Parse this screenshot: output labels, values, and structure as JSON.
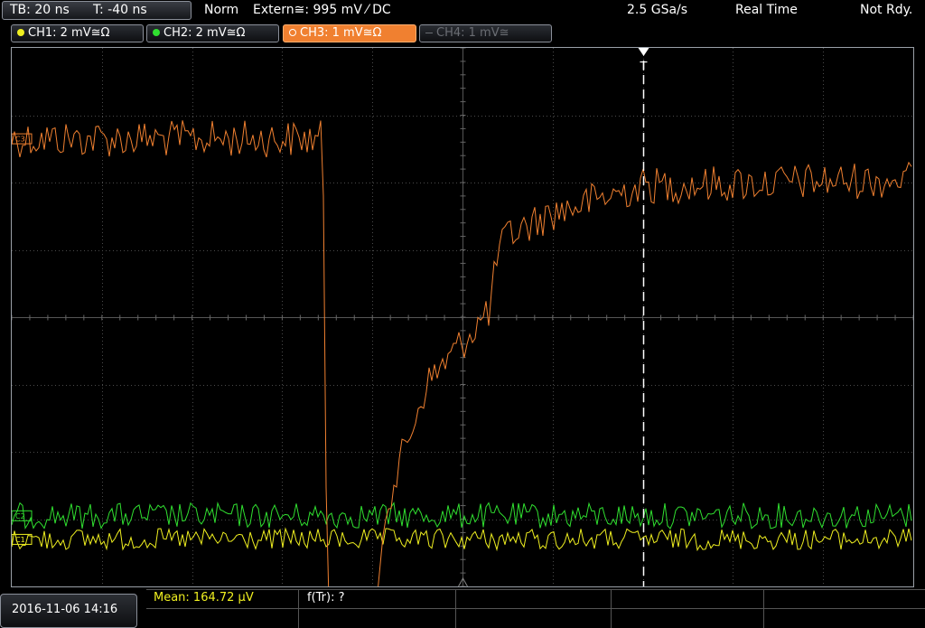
{
  "topbar": {
    "timebase": "TB: 20 ns",
    "trigger_time": "T: -40 ns",
    "trigger_mode": "Norm",
    "trigger_source": "Extern≅: 995 mV ⁄ DC",
    "sample_rate": "2.5 GSa/s",
    "acq_mode": "Real Time",
    "status": "Not Rdy."
  },
  "channels": [
    {
      "label": "CH1: 2 mV≅Ω",
      "color": "#f0f020",
      "state": "on"
    },
    {
      "label": "CH2: 2 mV≅Ω",
      "color": "#30e030",
      "state": "on"
    },
    {
      "label": "CH3: 1 mV≅Ω",
      "color": "#f08030",
      "state": "selected"
    },
    {
      "label": "CH4: 1 mV≅",
      "color": "#6a6d73",
      "state": "off"
    }
  ],
  "markers": {
    "ch3": "C3",
    "ch2": "C2",
    "ch1": "C1",
    "trigger": "T"
  },
  "footer": {
    "datetime": "2016-11-06 14:16",
    "measurement_1": "Mean: 164.72 µV",
    "measurement_2": "f(Tr): ?"
  },
  "colors": {
    "ch1": "#f0f020",
    "ch2": "#30e030",
    "ch3": "#f08030",
    "grid": "#4a4a4a"
  },
  "chart_data": {
    "type": "line",
    "grid_divisions": {
      "x": 10,
      "y": 8
    },
    "trigger_division": 7,
    "series": [
      {
        "channel": "CH3",
        "color": "#f08030",
        "shape": "flat high until ~3.45 div, drops off-screen, then rises from ~4.1 div to a plateau near 2.0 div by ~7 div",
        "levels": [
          [
            "0.0",
            1.35
          ],
          [
            "3.45",
            1.35
          ],
          [
            "3.5",
            8.2
          ],
          [
            "4.05",
            8.2
          ],
          [
            "4.15",
            6.8
          ],
          [
            "4.6",
            5.0
          ],
          [
            "5.3",
            3.9
          ],
          [
            "5.4",
            3.0
          ],
          [
            "5.5",
            2.8
          ],
          [
            "6.0",
            2.45
          ],
          [
            "7.0",
            2.05
          ],
          [
            "10.0",
            1.95
          ]
        ]
      },
      {
        "channel": "CH2",
        "color": "#30e030",
        "level_div": 6.95,
        "noise_div": 0.12
      },
      {
        "channel": "CH1",
        "color": "#f0f020",
        "level_div": 7.3,
        "noise_div": 0.1
      }
    ]
  }
}
